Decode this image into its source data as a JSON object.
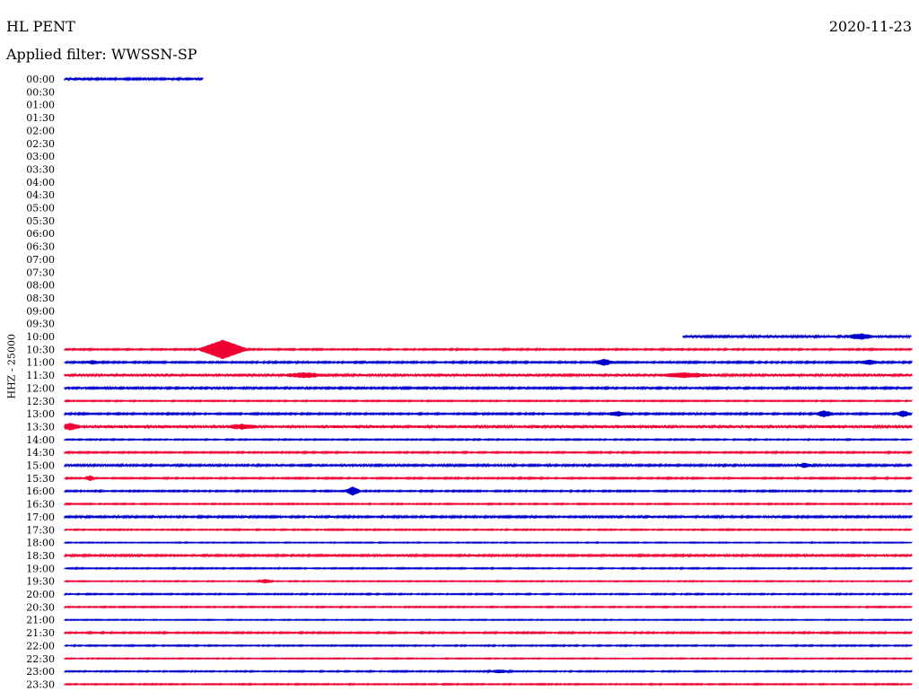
{
  "header": {
    "station": "HL PENT",
    "date": "2020-11-23",
    "filter": "Applied filter: WWSSN-SP",
    "channel": "HHZ - 25000"
  },
  "colors": {
    "blue": "#0000cc",
    "red": "#ee0033"
  },
  "chart_data": {
    "type": "line",
    "title": "HL PENT",
    "ylabel": "HHZ - 25000",
    "row_labels": [
      "00:00",
      "00:30",
      "01:00",
      "01:30",
      "02:00",
      "02:30",
      "03:00",
      "03:30",
      "04:00",
      "04:30",
      "05:00",
      "05:30",
      "06:00",
      "06:30",
      "07:00",
      "07:30",
      "08:00",
      "08:30",
      "09:00",
      "09:30",
      "10:00",
      "10:30",
      "11:00",
      "11:30",
      "12:00",
      "12:30",
      "13:00",
      "13:30",
      "14:00",
      "14:30",
      "15:00",
      "15:30",
      "16:00",
      "16:30",
      "17:00",
      "17:30",
      "18:00",
      "18:30",
      "19:00",
      "19:30",
      "20:00",
      "20:30",
      "21:00",
      "21:30",
      "22:00",
      "22:30",
      "23:00",
      "23:30"
    ],
    "x_minutes_range": [
      0,
      30
    ],
    "traces": [
      {
        "row": "00:00",
        "color": "blue",
        "start": 0,
        "end": 4.9,
        "noise": 0.8,
        "events": []
      },
      {
        "row": "10:00",
        "color": "blue",
        "start": 21.9,
        "end": 30,
        "noise": 0.9,
        "events": [
          {
            "t": 28.2,
            "amp": 2.5,
            "dur": 0.6
          }
        ]
      },
      {
        "row": "10:30",
        "color": "red",
        "start": 0,
        "end": 30,
        "noise": 0.6,
        "events": [
          {
            "t": 5.6,
            "amp": 10,
            "dur": 0.9
          }
        ]
      },
      {
        "row": "11:00",
        "color": "blue",
        "start": 0,
        "end": 30,
        "noise": 0.7,
        "events": [
          {
            "t": 1.0,
            "amp": 2,
            "dur": 0.2
          },
          {
            "t": 19.1,
            "amp": 3,
            "dur": 0.4
          },
          {
            "t": 28.5,
            "amp": 2,
            "dur": 0.5
          }
        ]
      },
      {
        "row": "11:30",
        "color": "red",
        "start": 0,
        "end": 30,
        "noise": 1.0,
        "events": [
          {
            "t": 8.5,
            "amp": 2,
            "dur": 0.8
          },
          {
            "t": 22,
            "amp": 2,
            "dur": 1
          }
        ]
      },
      {
        "row": "12:00",
        "color": "blue",
        "start": 0,
        "end": 30,
        "noise": 0.8,
        "events": []
      },
      {
        "row": "12:30",
        "color": "red",
        "start": 0,
        "end": 30,
        "noise": 0.5,
        "events": []
      },
      {
        "row": "13:00",
        "color": "blue",
        "start": 0,
        "end": 30,
        "noise": 0.7,
        "events": [
          {
            "t": 19.6,
            "amp": 2,
            "dur": 0.5
          },
          {
            "t": 26.9,
            "amp": 3,
            "dur": 0.4
          },
          {
            "t": 29.7,
            "amp": 3,
            "dur": 0.3
          }
        ]
      },
      {
        "row": "13:30",
        "color": "red",
        "start": 0,
        "end": 30,
        "noise": 1.2,
        "events": [
          {
            "t": 0.2,
            "amp": 3,
            "dur": 0.4
          },
          {
            "t": 6.3,
            "amp": 2,
            "dur": 0.6
          }
        ]
      },
      {
        "row": "14:00",
        "color": "blue",
        "start": 0,
        "end": 30,
        "noise": 0.5,
        "events": []
      },
      {
        "row": "14:30",
        "color": "red",
        "start": 0,
        "end": 30,
        "noise": 0.6,
        "events": []
      },
      {
        "row": "15:00",
        "color": "blue",
        "start": 0,
        "end": 30,
        "noise": 0.8,
        "events": [
          {
            "t": 26.2,
            "amp": 2,
            "dur": 0.3
          }
        ]
      },
      {
        "row": "15:30",
        "color": "red",
        "start": 0,
        "end": 30,
        "noise": 0.6,
        "events": [
          {
            "t": 0.9,
            "amp": 2.5,
            "dur": 0.2
          }
        ]
      },
      {
        "row": "16:00",
        "color": "blue",
        "start": 0,
        "end": 30,
        "noise": 0.6,
        "events": [
          {
            "t": 10.2,
            "amp": 4.5,
            "dur": 0.3
          }
        ]
      },
      {
        "row": "16:30",
        "color": "red",
        "start": 0,
        "end": 30,
        "noise": 0.5,
        "events": []
      },
      {
        "row": "17:00",
        "color": "blue",
        "start": 0,
        "end": 30,
        "noise": 0.8,
        "events": []
      },
      {
        "row": "17:30",
        "color": "red",
        "start": 0,
        "end": 30,
        "noise": 0.5,
        "events": []
      },
      {
        "row": "18:00",
        "color": "blue",
        "start": 0,
        "end": 30,
        "noise": 0.4,
        "events": []
      },
      {
        "row": "18:30",
        "color": "red",
        "start": 0,
        "end": 30,
        "noise": 0.8,
        "events": []
      },
      {
        "row": "19:00",
        "color": "blue",
        "start": 0,
        "end": 30,
        "noise": 0.5,
        "events": []
      },
      {
        "row": "19:30",
        "color": "red",
        "start": 0,
        "end": 30,
        "noise": 0.4,
        "events": [
          {
            "t": 7.1,
            "amp": 2,
            "dur": 0.3
          }
        ]
      },
      {
        "row": "20:00",
        "color": "blue",
        "start": 0,
        "end": 30,
        "noise": 0.5,
        "events": []
      },
      {
        "row": "20:30",
        "color": "red",
        "start": 0,
        "end": 30,
        "noise": 0.5,
        "events": []
      },
      {
        "row": "21:00",
        "color": "blue",
        "start": 0,
        "end": 30,
        "noise": 0.4,
        "events": []
      },
      {
        "row": "21:30",
        "color": "red",
        "start": 0,
        "end": 30,
        "noise": 0.6,
        "events": []
      },
      {
        "row": "22:00",
        "color": "blue",
        "start": 0,
        "end": 30,
        "noise": 0.5,
        "events": []
      },
      {
        "row": "22:30",
        "color": "red",
        "start": 0,
        "end": 30,
        "noise": 0.4,
        "events": []
      },
      {
        "row": "23:00",
        "color": "blue",
        "start": 0,
        "end": 30,
        "noise": 0.5,
        "events": [
          {
            "t": 15.4,
            "amp": 1.5,
            "dur": 0.5
          }
        ]
      },
      {
        "row": "23:30",
        "color": "red",
        "start": 0,
        "end": 30,
        "noise": 0.5,
        "events": []
      }
    ]
  }
}
